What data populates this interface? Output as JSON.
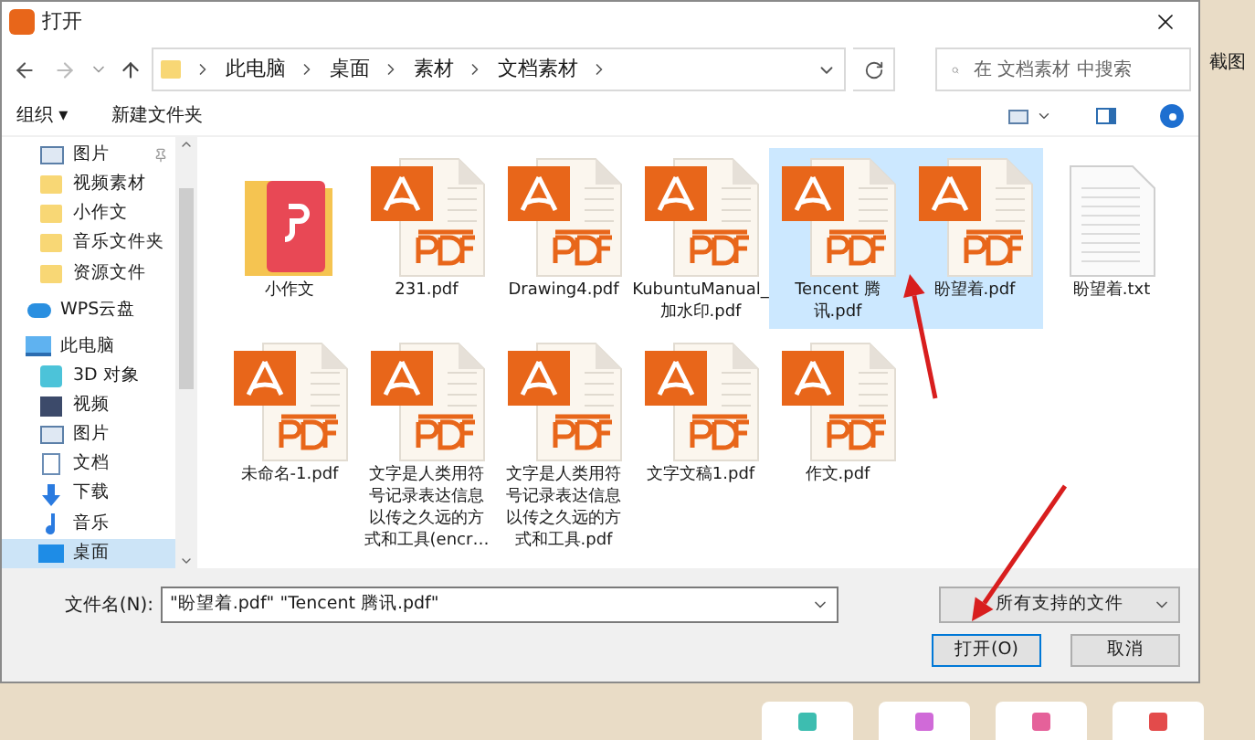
{
  "window": {
    "title": "打开"
  },
  "address": {
    "crumbs": [
      "此电脑",
      "桌面",
      "素材",
      "文档素材"
    ],
    "search_placeholder": "在 文档素材 中搜索"
  },
  "toolbar": {
    "organize": "组织 ▾",
    "new_folder": "新建文件夹"
  },
  "background": {
    "label": "截图"
  },
  "sidebar": {
    "items": [
      {
        "kind": "picture",
        "label": "图片",
        "selected": false
      },
      {
        "kind": "folder",
        "label": "视频素材",
        "selected": false
      },
      {
        "kind": "folder",
        "label": "小作文",
        "selected": false
      },
      {
        "kind": "folder",
        "label": "音乐文件夹",
        "selected": false
      },
      {
        "kind": "folder",
        "label": "资源文件",
        "selected": false
      },
      {
        "kind": "cloud",
        "label": "WPS云盘",
        "selected": false
      },
      {
        "kind": "computer",
        "label": "此电脑",
        "selected": false
      },
      {
        "kind": "cube",
        "label": "3D 对象",
        "selected": false
      },
      {
        "kind": "video",
        "label": "视频",
        "selected": false
      },
      {
        "kind": "picture",
        "label": "图片",
        "selected": false
      },
      {
        "kind": "document",
        "label": "文档",
        "selected": false
      },
      {
        "kind": "download",
        "label": "下载",
        "selected": false
      },
      {
        "kind": "music",
        "label": "音乐",
        "selected": false
      },
      {
        "kind": "desktop",
        "label": "桌面",
        "selected": true
      }
    ]
  },
  "files": [
    {
      "kind": "app-folder",
      "name": "小作文",
      "selected": false
    },
    {
      "kind": "pdf",
      "name": "231.pdf",
      "selected": false
    },
    {
      "kind": "pdf",
      "name": "Drawing4.pdf",
      "selected": false
    },
    {
      "kind": "pdf",
      "name": "KubuntuManual_加水印.pdf",
      "selected": false
    },
    {
      "kind": "pdf",
      "name": "Tencent 腾讯.pdf",
      "selected": true
    },
    {
      "kind": "pdf",
      "name": "盼望着.pdf",
      "selected": true
    },
    {
      "kind": "txt",
      "name": "盼望着.txt",
      "selected": false
    },
    {
      "kind": "pdf",
      "name": "未命名-1.pdf",
      "selected": false
    },
    {
      "kind": "pdf",
      "name": "文字是人类用符号记录表达信息以传之久远的方式和工具(encr…",
      "selected": false
    },
    {
      "kind": "pdf",
      "name": "文字是人类用符号记录表达信息以传之久远的方式和工具.pdf",
      "selected": false
    },
    {
      "kind": "pdf",
      "name": "文字文稿1.pdf",
      "selected": false
    },
    {
      "kind": "pdf",
      "name": "作文.pdf",
      "selected": false
    }
  ],
  "footer": {
    "filename_label": "文件名(N):",
    "filename_value": "\"盼望着.pdf\" \"Tencent 腾讯.pdf\"",
    "filetype": "所有支持的文件",
    "open": "打开(O)",
    "cancel": "取消"
  }
}
